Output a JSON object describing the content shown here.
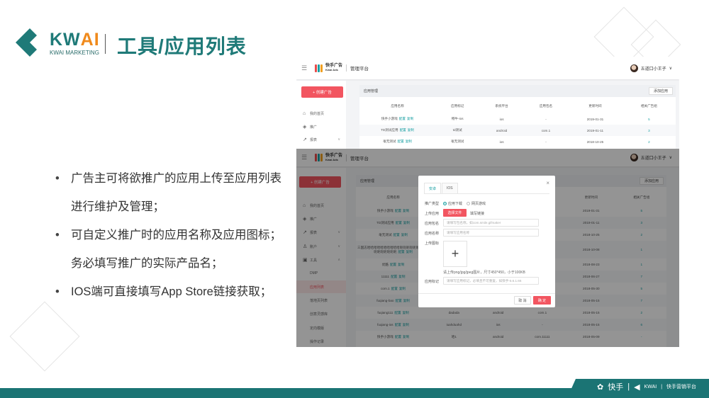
{
  "brand": {
    "logo_text_1": "KW",
    "logo_text_2": "AI",
    "logo_sub": "KWAI MARKETING"
  },
  "slide_title": "工具/应用列表",
  "bullets": [
    "广告主可将欲推广的应用上传至应用列表进行维护及管理；",
    "可自定义推广时的应用名称及应用图标；务必填写推广的实际产品名；",
    "IOS端可直接填写App Store链接获取；"
  ],
  "footer": {
    "kuaishou": "快手",
    "kwai": "KWAI",
    "platform": "快手营销平台"
  },
  "app": {
    "logo_cn": "快手广告",
    "logo_en": "Kwai Ads",
    "platform": "管理平台",
    "user": "五道口小王子",
    "create": "+ 创建广告",
    "menu": {
      "home": "我的首页",
      "promote": "推广",
      "report": "报表",
      "account": "账户",
      "tools": "工具",
      "dmp": "DMP",
      "applist": "应用列表",
      "landing": "落地页列表",
      "creative": "创意灵感库",
      "target": "定向模版",
      "log": "操作记录"
    },
    "panel_title": "应用管理",
    "add_app": "添加应用",
    "link_config": "配置",
    "link_copy": "复制",
    "columns": [
      "应用名称",
      "应用标记",
      "系统平台",
      "应用包名",
      "更新时间",
      "相关广告组"
    ],
    "rows": [
      [
        "快手小游戏",
        "畅牛-ios",
        "ios",
        "-",
        "2019-01-31",
        "5"
      ],
      [
        "TD测试应用",
        "td测试",
        "android",
        "com.1",
        "2019-01-11",
        "3"
      ],
      [
        "毫无测试",
        "毫无测试",
        "ios",
        "-",
        "2018-10-25",
        "2"
      ],
      [
        "三国志哈哈哈哈哈哈哈哈哈哈呃呃呃呃呃呃呃呃呃呃呃呃呃呃呃呃",
        "",
        "",
        "",
        "2018-10-08",
        "1"
      ],
      [
        "优酷",
        "",
        "",
        "",
        "2018-08-23",
        "1"
      ],
      [
        "11111",
        "",
        "",
        "",
        "2018-06-27",
        "7"
      ],
      [
        "com.1",
        "",
        "",
        "",
        "2018-05-30",
        "5"
      ],
      [
        "fuqiang-bao",
        "",
        "",
        "",
        "2018-05-15",
        "7"
      ],
      [
        "fuqiang111",
        "dadada",
        "android",
        "com.1",
        "2018-05-15",
        "2"
      ],
      [
        "fuqiang-ios",
        "iuahduahd",
        "ios",
        "-",
        "2018-05-15",
        "6"
      ],
      [
        "快手小游戏",
        "哈1",
        "android",
        "com.11111",
        "2018-05-09",
        "-"
      ]
    ]
  },
  "modal": {
    "tab_android": "安卓",
    "tab_ios": "IOS",
    "close": "×",
    "promo_type_label": "推广类型",
    "opt_download": "应用下载",
    "opt_webgame": "网页游戏",
    "upload_app_label": "上传应用",
    "choose_file": "选择文件",
    "fill_link": "填写链接",
    "pkg_label": "应用包名",
    "pkg_placeholder": "请填写包名称，如com.smile.gifmaker",
    "name_label": "应用名称",
    "name_placeholder": "请填写应用名称",
    "icon_label": "上传图标",
    "plus": "+",
    "icon_hint": "请上传png/jpg/jpeg图片，尺寸450*450，小于100KB",
    "tag_label": "应用标记",
    "tag_placeholder": "请填写应用标记，必填且不可重复，如快手-5.6.1.66",
    "cancel": "取 消",
    "ok": "确 定"
  },
  "colors": {
    "teal": "#1f7a78",
    "orange": "#f08a1c",
    "red": "#f25560",
    "link": "#1aa0a3"
  }
}
